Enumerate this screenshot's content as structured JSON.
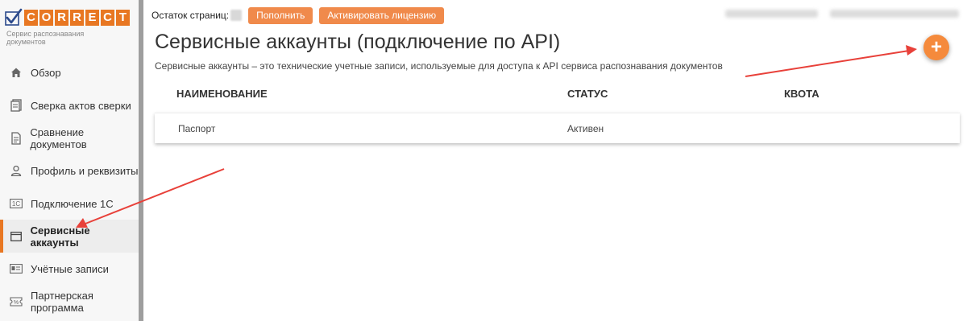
{
  "logo": {
    "letters": [
      "C",
      "O",
      "R",
      "R",
      "E",
      "C",
      "T"
    ],
    "tagline": "Сервис распознавания документов"
  },
  "topbar": {
    "pages_label": "Остаток страниц:",
    "topup_label": "Пополнить",
    "activate_label": "Активировать лицензию"
  },
  "sidebar": {
    "items": [
      {
        "label": "Обзор",
        "icon": "home-icon"
      },
      {
        "label": "Сверка актов сверки",
        "icon": "document-icon"
      },
      {
        "label": "Сравнение документов",
        "icon": "compare-documents-icon"
      },
      {
        "label": "Профиль и реквизиты",
        "icon": "user-icon"
      },
      {
        "label": "Подключение 1С",
        "icon": "1c-icon"
      },
      {
        "label": "Сервисные аккаунты",
        "icon": "window-icon",
        "active": true
      },
      {
        "label": "Учётные записи",
        "icon": "id-card-icon"
      },
      {
        "label": "Партнерская программа",
        "icon": "percent-ticket-icon"
      }
    ]
  },
  "main": {
    "title": "Сервисные аккаунты (подключение по API)",
    "description": "Сервисные аккаунты – это технические учетные записи, используемые для доступа к API сервиса распознавания документов",
    "add_label": "+",
    "table": {
      "columns": [
        "НАИМЕНОВАНИЕ",
        "СТАТУС",
        "КВОТА"
      ],
      "rows": [
        {
          "name": "Паспорт",
          "status": "Активен",
          "quota": ""
        }
      ]
    }
  },
  "colors": {
    "accent": "#e87722",
    "button": "#f08a4b",
    "fab": "#f58a3c",
    "annotation_arrow": "#e8413a"
  }
}
